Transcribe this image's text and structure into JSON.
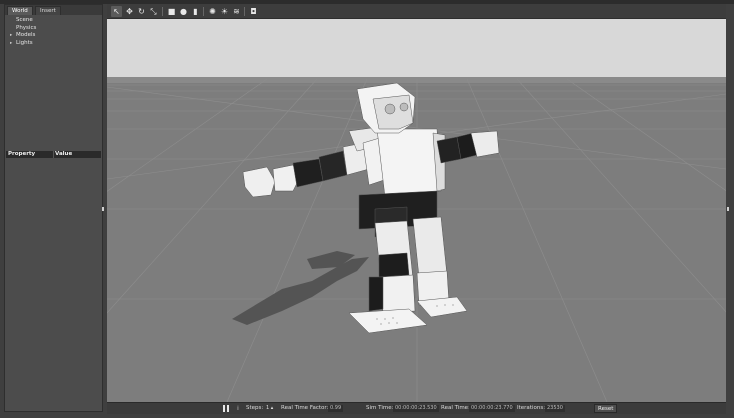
{
  "left_panel": {
    "tabs": [
      {
        "label": "World"
      },
      {
        "label": "Insert"
      }
    ],
    "tree": [
      {
        "label": "Scene",
        "expandable": false
      },
      {
        "label": "Physics",
        "expandable": false
      },
      {
        "label": "Models",
        "expandable": true
      },
      {
        "label": "Lights",
        "expandable": true
      }
    ],
    "properties": {
      "col_property": "Property",
      "col_value": "Value"
    }
  },
  "toolbar": {
    "tools": [
      {
        "icon": "arrow-select-icon",
        "glyph": "↖",
        "active": true
      },
      {
        "icon": "translate-icon",
        "glyph": "✥"
      },
      {
        "icon": "rotate-icon",
        "glyph": "↻"
      },
      {
        "icon": "scale-icon",
        "glyph": "⤡"
      },
      {
        "icon": "box-shape-icon",
        "glyph": "■"
      },
      {
        "icon": "sphere-shape-icon",
        "glyph": "●"
      },
      {
        "icon": "cylinder-shape-icon",
        "glyph": "▮"
      },
      {
        "icon": "point-light-icon",
        "glyph": "✺"
      },
      {
        "icon": "spot-light-icon",
        "glyph": "☀"
      },
      {
        "icon": "directional-light-icon",
        "glyph": "≋"
      },
      {
        "icon": "camera-screenshot-icon",
        "glyph": "◘"
      }
    ]
  },
  "bottom_bar": {
    "steps_label": "Steps:",
    "steps_value": "1",
    "real_time_factor_label": "Real Time Factor:",
    "real_time_factor_value": "0.99",
    "sim_time_label": "Sim Time:",
    "sim_time_value": "00:00:00:23.530",
    "real_time_label": "Real Time:",
    "real_time_value": "00:00:00:23.770",
    "iterations_label": "Iterations:",
    "iterations_value": "23530",
    "reset_label": "Reset"
  },
  "colors": {
    "sky": "#dadada",
    "ground": "#7e7e7e",
    "panel": "#4c4c4c",
    "robot_white": "#f2f2f2",
    "robot_black": "#1e1e1e"
  }
}
